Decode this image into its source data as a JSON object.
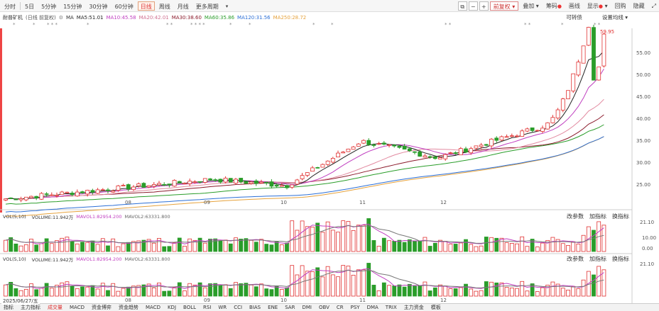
{
  "toolbar": {
    "periods": [
      "分时",
      "5日",
      "5分钟",
      "15分钟",
      "30分钟",
      "60分钟",
      "日线",
      "周线",
      "月线",
      "更多周期"
    ],
    "selected_period": "日线",
    "zoom_minus": "−",
    "zoom_plus": "+",
    "fuquan": "前复权",
    "overlay": "叠加",
    "chips": "筹码",
    "draw": "画线",
    "display": "显示",
    "buyback": "回购",
    "hide": "隐藏"
  },
  "info": {
    "stock_name": "耐普矿机",
    "adjust_note": "(日线 前复权)",
    "ma_label": "MA",
    "ma5": "MA5:51.01",
    "ma10": "MA10:45.58",
    "ma20": "MA20:42.01",
    "ma30": "MA30:38.60",
    "ma60": "MA60:35.86",
    "ma120": "MA120:31.56",
    "ma250": "MA250:28.72",
    "convertible": "可转债",
    "set_ma": "设置均线"
  },
  "colors": {
    "up": "#e03030",
    "down": "#2a9d2a",
    "ma5": "#222222",
    "ma10": "#c03fc0",
    "ma20": "#e28aa0",
    "ma30": "#8b1a2b",
    "ma60": "#2a9d2a",
    "ma120": "#2c6fd6",
    "ma250": "#e6a23c"
  },
  "price_axis": {
    "ticks": [
      "55.00",
      "50.00",
      "45.00",
      "40.00",
      "35.00",
      "30.00",
      "25.00"
    ],
    "high_label": "59.95"
  },
  "vol_panel": {
    "indicator": "VOL(5,10)",
    "volume": "VOLUME:11.942万",
    "mavol1": "MAVOL1:82954.200",
    "mavol2": "MAVOL2:63331.800",
    "links": [
      "改参数",
      "加指标",
      "换指标"
    ],
    "ticks": [
      "21.10",
      "10.00",
      "0.00"
    ]
  },
  "vol_panel2": {
    "indicator": "VOL(5,10)",
    "volume": "VOLUME:11.942万",
    "mavol1": "MAVOL1:82954.200",
    "mavol2": "MAVOL2:63331.800",
    "links": [
      "改参数",
      "加指标",
      "换指标"
    ],
    "ticks": [
      "21.10"
    ]
  },
  "months": [
    "08",
    "09",
    "10",
    "11",
    "12"
  ],
  "date_tag": "2025/06/27/五",
  "bottom_tabs": [
    "指标",
    "主力指标",
    "成交量",
    "MACD",
    "资金博弈",
    "资金趋势",
    "MACD",
    "KDJ",
    "BOLL",
    "RSI",
    "WR",
    "CCI",
    "BIAS",
    "ENE",
    "SAR",
    "DMI",
    "OBV",
    "CR",
    "PSY",
    "DMA",
    "TRIX",
    "主力资金",
    "模板"
  ],
  "bottom_tab_active": "成交量"
}
